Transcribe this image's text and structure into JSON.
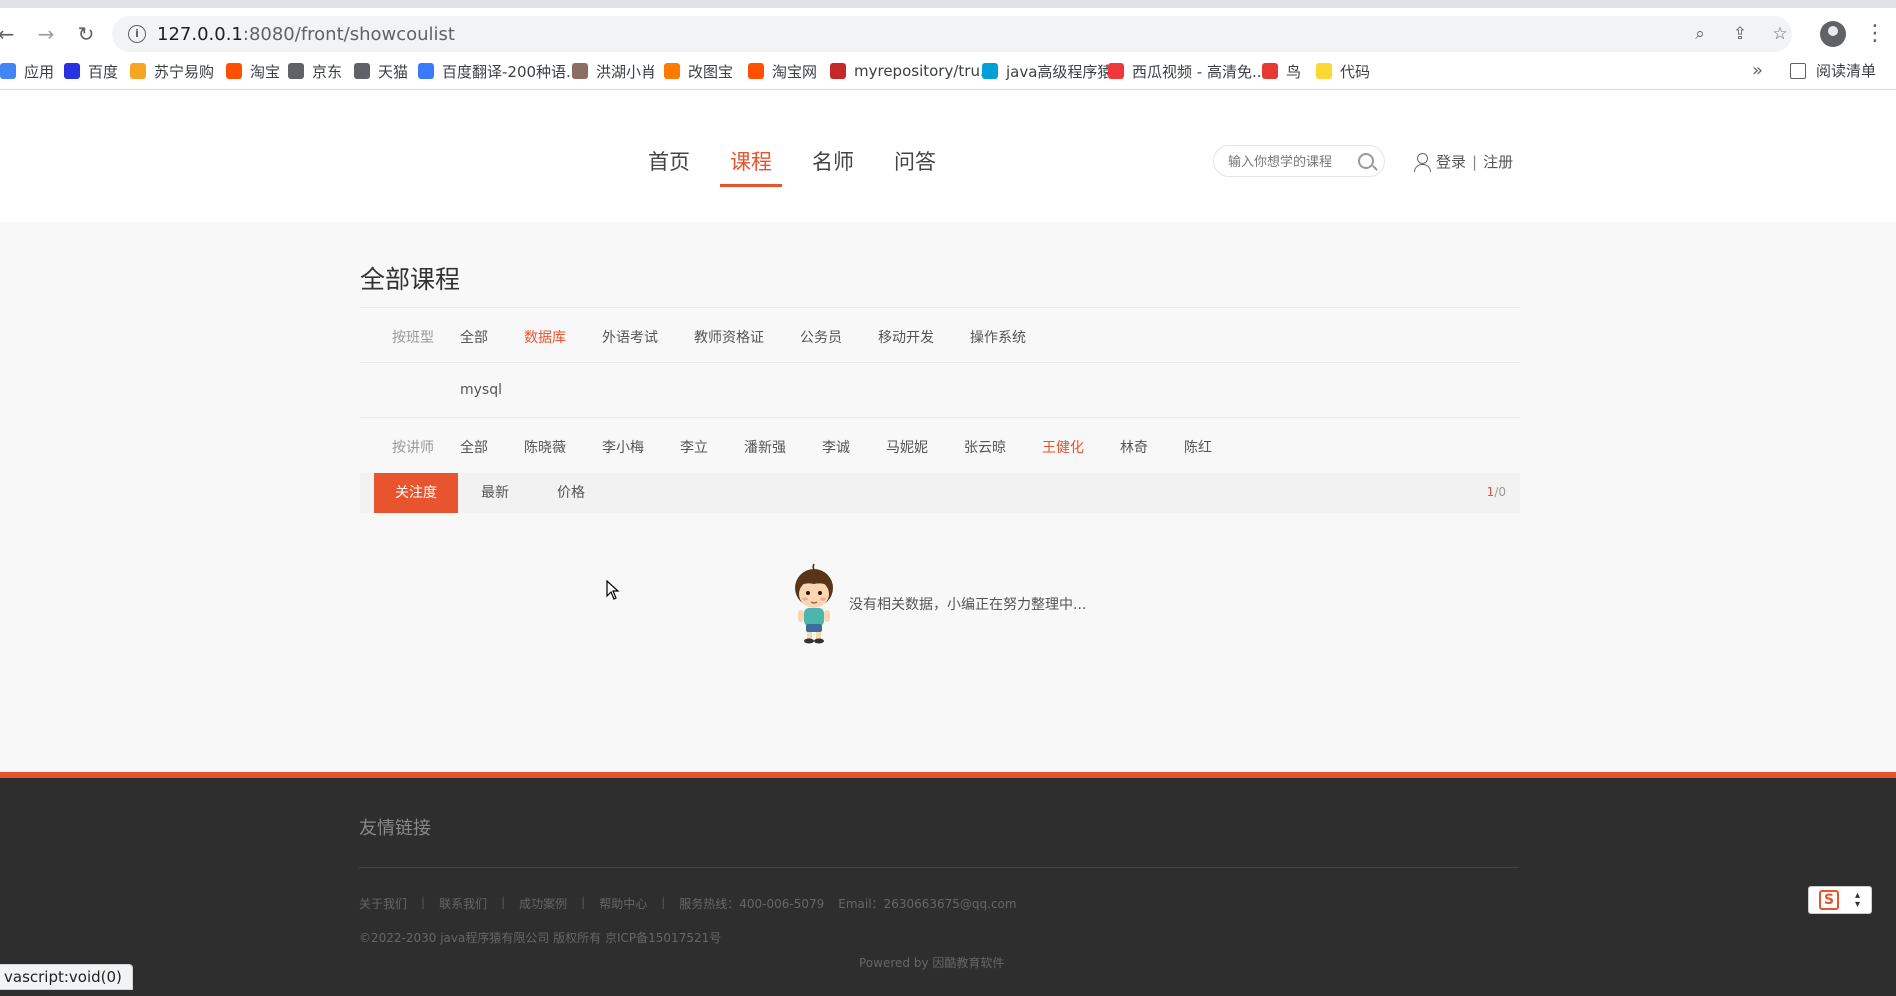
{
  "browser": {
    "url_host": "127.0.0.1",
    "url_rest": ":8080/front/showcoulist",
    "bookmarks": [
      {
        "label": "应用",
        "color": "#4285f4"
      },
      {
        "label": "百度",
        "color": "#2932e1"
      },
      {
        "label": "苏宁易购",
        "color": "#f5a623"
      },
      {
        "label": "淘宝",
        "color": "#ff5000"
      },
      {
        "label": "京东",
        "color": "#5f6368"
      },
      {
        "label": "天猫",
        "color": "#5f6368"
      },
      {
        "label": "百度翻译-200种语...",
        "color": "#3a7bfd"
      },
      {
        "label": "洪湖小肖",
        "color": "#8d6e63"
      },
      {
        "label": "改图宝",
        "color": "#ff7a00"
      },
      {
        "label": "淘宝网",
        "color": "#ff5000"
      },
      {
        "label": "myrepository/tru...",
        "color": "#c62828"
      },
      {
        "label": "java高级程序猿",
        "color": "#00a1d6"
      },
      {
        "label": "西瓜视频 - 高清免...",
        "color": "#f0383a"
      },
      {
        "label": "鸟",
        "color": "#e53935"
      },
      {
        "label": "代码",
        "color": "#fdd835"
      }
    ],
    "bookmarks_more": "»",
    "reading_list": "阅读清单",
    "status_text": "vascript:void(0)"
  },
  "site": {
    "nav": [
      "首页",
      "课程",
      "名师",
      "问答"
    ],
    "active_nav": "课程",
    "search_placeholder": "输入你想学的课程",
    "login": "登录",
    "separator": "|",
    "register": "注册"
  },
  "main": {
    "title": "全部课程",
    "type_filter": {
      "label": "按班型",
      "options": [
        "全部",
        "数据库",
        "外语考试",
        "教师资格证",
        "公务员",
        "移动开发",
        "操作系统"
      ],
      "active": "数据库"
    },
    "sub_filter": {
      "options": [
        "mysql"
      ]
    },
    "teacher_filter": {
      "label": "按讲师",
      "options": [
        "全部",
        "陈晓薇",
        "李小梅",
        "李立",
        "潘新强",
        "李诚",
        "马妮妮",
        "张云晾",
        "王健化",
        "林奇",
        "陈红"
      ],
      "active": "王健化"
    },
    "sort": {
      "options": [
        "关注度",
        "最新",
        "价格"
      ],
      "active": "关注度",
      "page_current": "1",
      "page_total": "/0"
    },
    "empty_message": "没有相关数据，小编正在努力整理中..."
  },
  "footer": {
    "title": "友情链接",
    "links": [
      "关于我们",
      "联系我们",
      "成功案例",
      "帮助中心",
      "服务热线：400-006-5079",
      "Email：2630663675@qq.com"
    ],
    "copyright": "©2022-2030 java程序猿有限公司 版权所有 京ICP备15017521号",
    "powered": "Powered by 因酷教育软件",
    "accent_color": "#e8542e"
  }
}
